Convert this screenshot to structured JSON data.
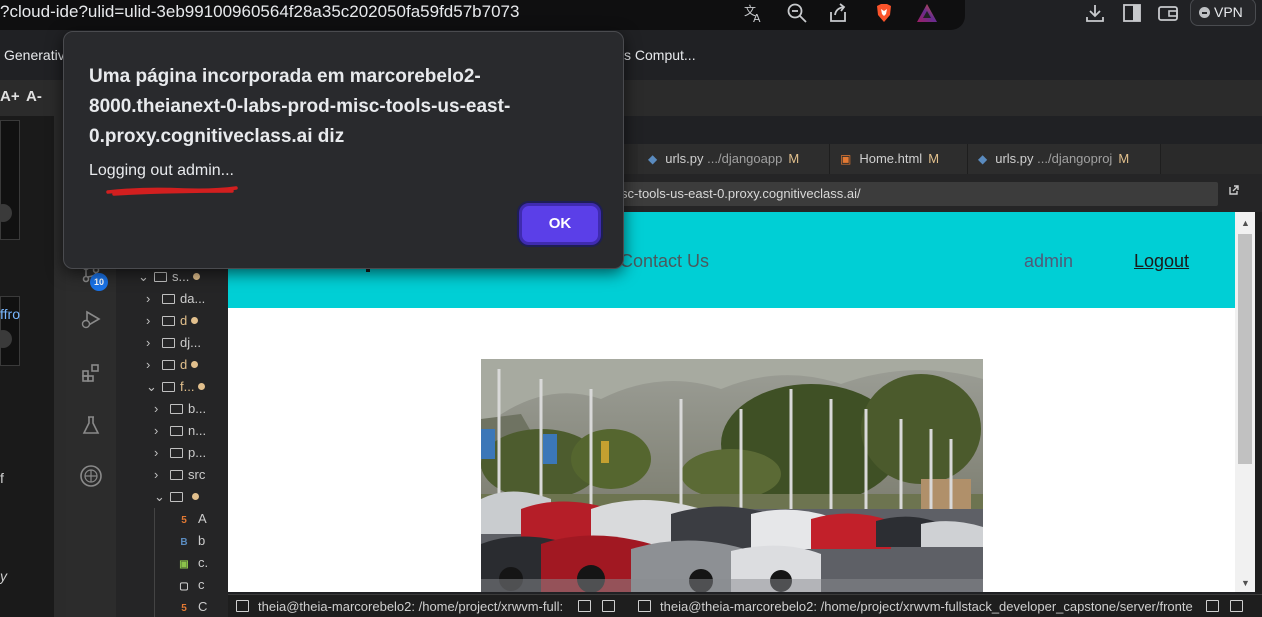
{
  "browser": {
    "url_text": "?cloud-ide?ulid=ulid-3eb99100960564f28a35c202050fa59fd57b7073",
    "vpn_label": "VPN",
    "icons": [
      "translate-icon",
      "zoom-icon",
      "share-icon",
      "brave-shield-icon",
      "brave-rewards-icon",
      "download-icon",
      "sidebar-icon",
      "wallet-icon"
    ]
  },
  "bookmarks": {
    "left_partial": "Generativ",
    "right_partial": "s Comput..."
  },
  "ide": {
    "font_increase": "A+",
    "font_decrease": "A-",
    "left_pane_fragments": [
      "ffro",
      "f",
      "y"
    ],
    "scm_badge": "10",
    "explorer": [
      {
        "label": "s...",
        "expanded": true,
        "modified": true
      },
      {
        "label": "da...",
        "expanded": false,
        "modified": false
      },
      {
        "label": "d",
        "expanded": false,
        "modified": true
      },
      {
        "label": "dj...",
        "expanded": false,
        "modified": false
      },
      {
        "label": "d",
        "expanded": false,
        "modified": true
      },
      {
        "label": "f...",
        "expanded": true,
        "modified": true
      },
      {
        "label": "b...",
        "expanded": false,
        "modified": false
      },
      {
        "label": "n...",
        "expanded": false,
        "modified": false
      },
      {
        "label": "p...",
        "expanded": false,
        "modified": false
      },
      {
        "label": "src",
        "expanded": false,
        "modified": false
      },
      {
        "label": "",
        "expanded": true,
        "modified": true
      }
    ],
    "files": [
      {
        "label": "A",
        "icon": "html-file-icon",
        "color": "#e37933"
      },
      {
        "label": "b",
        "icon": "bootstrap-file-icon",
        "color": "#5a8bbf"
      },
      {
        "label": "c.",
        "icon": "image-file-icon",
        "color": "#8bc34a"
      },
      {
        "label": "c",
        "icon": "file-icon",
        "color": "#cfcfcf"
      },
      {
        "label": "C",
        "icon": "html-file-icon",
        "color": "#e37933"
      }
    ],
    "tabs": [
      {
        "file": "urls.py",
        "path": ".../djangoapp",
        "status": "M",
        "type": "python"
      },
      {
        "file": "Home.html",
        "path": "",
        "status": "M",
        "type": "html"
      },
      {
        "file": "urls.py",
        "path": ".../djangoproj",
        "status": "M",
        "type": "python"
      }
    ],
    "preview_url": "sc-tools-us-east-0.proxy.cognitiveclass.ai/",
    "terminals": [
      "theia@theia-marcorebelo2: /home/project/xrwvm-full:",
      "theia@theia-marcorebelo2: /home/project/xrwvm-fullstack_developer_capstone/server/fronte"
    ]
  },
  "webpage": {
    "nav_contact": "Contact Us",
    "nav_user": "admin",
    "nav_logout": "Logout",
    "hero_alt": "car lot image"
  },
  "dialog": {
    "title": "Uma página incorporada em marcorebelo2-8000.theianext-0-labs-prod-misc-tools-us-east-0.proxy.cognitiveclass.ai diz",
    "message": "Logging out admin...",
    "ok_label": "OK"
  },
  "colors": {
    "navbar": "#00cfd5",
    "ok_button": "#5b3fe8",
    "modified": "#e2c08d",
    "badge": "#1a73e8"
  }
}
